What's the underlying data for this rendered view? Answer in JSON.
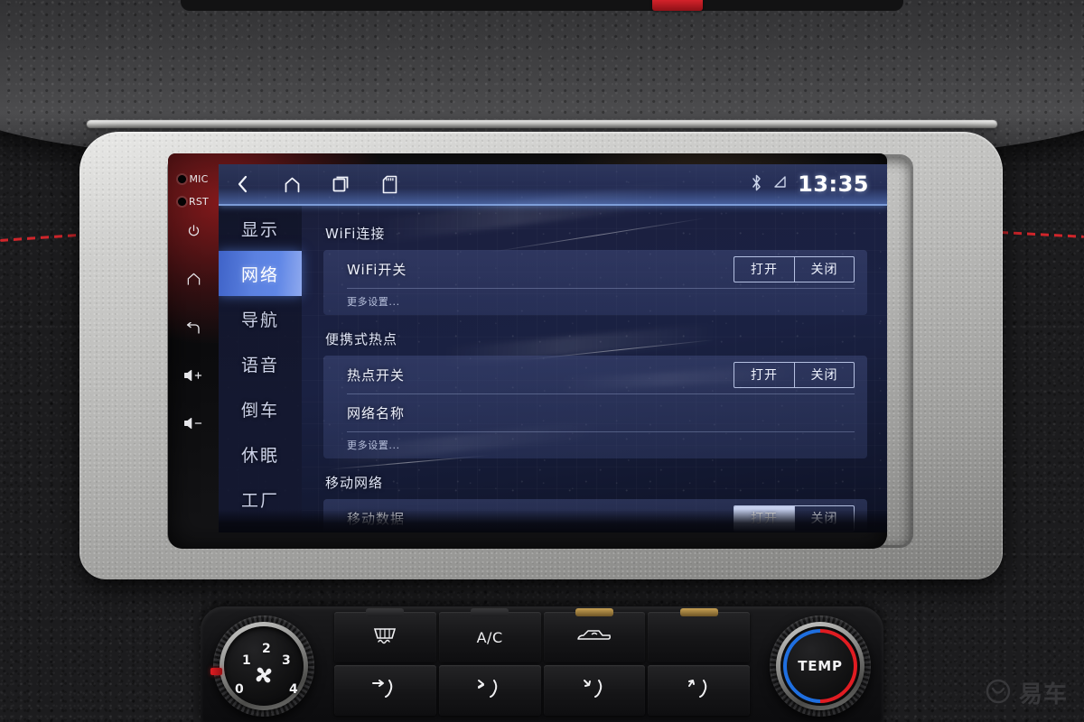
{
  "device": {
    "bezel_buttons": [
      {
        "name": "MIC",
        "label": "MIC",
        "type": "hole"
      },
      {
        "name": "RST",
        "label": "RST",
        "type": "hole"
      },
      {
        "name": "power",
        "label": "",
        "type": "icon"
      },
      {
        "name": "home",
        "label": "",
        "type": "icon"
      },
      {
        "name": "back",
        "label": "",
        "type": "icon"
      },
      {
        "name": "volume-up",
        "label": "",
        "type": "icon"
      },
      {
        "name": "volume-down",
        "label": "",
        "type": "icon"
      }
    ]
  },
  "statusbar": {
    "nav": [
      {
        "name": "back-icon",
        "label": "back"
      },
      {
        "name": "home-icon",
        "label": "home"
      },
      {
        "name": "recents-icon",
        "label": "recents"
      },
      {
        "name": "sdcard-icon",
        "label": "sd card"
      }
    ],
    "bluetooth_icon": "bluetooth-icon",
    "signal_icon": "signal-icon",
    "clock": "13:35"
  },
  "sidebar": {
    "items": [
      {
        "label": "显示",
        "active": false
      },
      {
        "label": "网络",
        "active": true
      },
      {
        "label": "导航",
        "active": false
      },
      {
        "label": "语音",
        "active": false
      },
      {
        "label": "倒车",
        "active": false
      },
      {
        "label": "休眠",
        "active": false
      },
      {
        "label": "工厂",
        "active": false
      }
    ]
  },
  "content": {
    "sections": [
      {
        "title": "WiFi连接",
        "rows": [
          {
            "label": "WiFi开关",
            "type": "toggle",
            "on_label": "打开",
            "off_label": "关闭",
            "selected": "none"
          },
          {
            "label": "更多设置...",
            "type": "link"
          }
        ]
      },
      {
        "title": "便携式热点",
        "rows": [
          {
            "label": "热点开关",
            "type": "toggle",
            "on_label": "打开",
            "off_label": "关闭",
            "selected": "none"
          },
          {
            "label": "网络名称",
            "type": "value",
            "value": ""
          },
          {
            "label": "更多设置...",
            "type": "link"
          }
        ]
      },
      {
        "title": "移动网络",
        "rows": [
          {
            "label": "移动数据",
            "type": "toggle",
            "on_label": "打开",
            "off_label": "关闭",
            "selected": "on"
          }
        ]
      }
    ]
  },
  "hvac": {
    "fan_knob": {
      "name": "fan-speed-knob",
      "positions": [
        "0",
        "1",
        "2",
        "3",
        "4"
      ],
      "current": "0",
      "icon": "fan-icon"
    },
    "temp_knob": {
      "name": "temperature-knob",
      "label": "TEMP",
      "cold_color": "#1f6fe0",
      "hot_color": "#e01c22"
    },
    "buttons": [
      {
        "name": "rear-defrost-button",
        "label": "",
        "icon": "defrost-icon",
        "indicator": "dim"
      },
      {
        "name": "ac-button",
        "label": "A/C",
        "icon": "text",
        "indicator": "dim"
      },
      {
        "name": "recirculation-button",
        "label": "",
        "icon": "recirc-icon",
        "indicator": "lit"
      },
      {
        "name": "blank-button-1",
        "label": "",
        "icon": "none",
        "indicator": "lit"
      },
      {
        "name": "airflow-face-button",
        "label": "",
        "icon": "airflow-face-icon",
        "indicator": "none"
      },
      {
        "name": "airflow-face-feet-button",
        "label": "",
        "icon": "airflow-bi-icon",
        "indicator": "none"
      },
      {
        "name": "airflow-feet-button",
        "label": "",
        "icon": "airflow-feet-icon",
        "indicator": "none"
      },
      {
        "name": "airflow-defrost-button",
        "label": "",
        "icon": "airflow-defrost-icon",
        "indicator": "none"
      }
    ]
  },
  "watermark": {
    "text": "易车",
    "icon": "yiche-logo-icon"
  },
  "colors": {
    "accent_blue": "#5b81e0",
    "status_bar_edge": "#96beff",
    "screen_bg": "#1a2142",
    "bezel_silver": "#c0c0be",
    "temp_cold": "#1f6fe0",
    "temp_hot": "#e01c22"
  }
}
